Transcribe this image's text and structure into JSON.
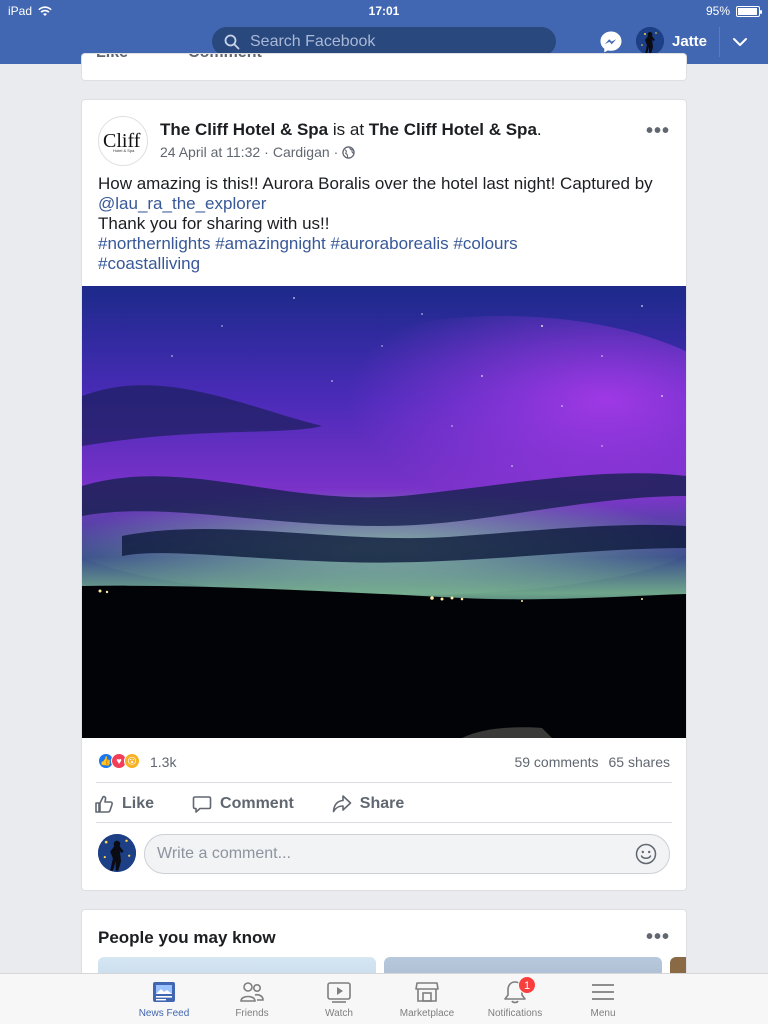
{
  "status_bar": {
    "device": "iPad",
    "time": "17:01",
    "battery": "95%",
    "battery_level": 0.95
  },
  "header": {
    "search_placeholder": "Search Facebook",
    "user_name": "Jatte"
  },
  "previous_post": {
    "like_label": "Like",
    "comment_label": "Comment"
  },
  "post": {
    "page_name": "The Cliff Hotel & Spa",
    "is_at": "is at",
    "location_name": "The Cliff Hotel & Spa",
    "location_suffix": ".",
    "logo_text": "Cliff",
    "logo_sub": "Hotel & Spa",
    "timestamp": "24 April at 11:32",
    "place": "Cardigan",
    "meta_sep": "·",
    "text_line1": "How amazing is this!! Aurora Boralis over the hotel last night! Captured by",
    "mention": "@lau_ra_the_explorer",
    "text_line2": "Thank you for sharing with us!!",
    "hashtags": [
      "#northernlights",
      "#amazingnight",
      "#auroraborealis",
      "#colours",
      "#coastalliving"
    ],
    "reaction_count": "1.3k",
    "comments": "59 comments",
    "shares": "65 shares",
    "actions": {
      "like": "Like",
      "comment": "Comment",
      "share": "Share"
    },
    "comment_placeholder": "Write a comment..."
  },
  "pymk": {
    "title": "People you may know"
  },
  "tabs": [
    {
      "label": "News Feed",
      "icon": "news-feed-icon",
      "active": true
    },
    {
      "label": "Friends",
      "icon": "friends-icon"
    },
    {
      "label": "Watch",
      "icon": "watch-icon"
    },
    {
      "label": "Marketplace",
      "icon": "marketplace-icon"
    },
    {
      "label": "Notifications",
      "icon": "notifications-icon",
      "badge": "1"
    },
    {
      "label": "Menu",
      "icon": "menu-icon"
    }
  ],
  "colors": {
    "brand": "#4267b2",
    "link": "#385898",
    "badge": "#fa3e3e"
  }
}
